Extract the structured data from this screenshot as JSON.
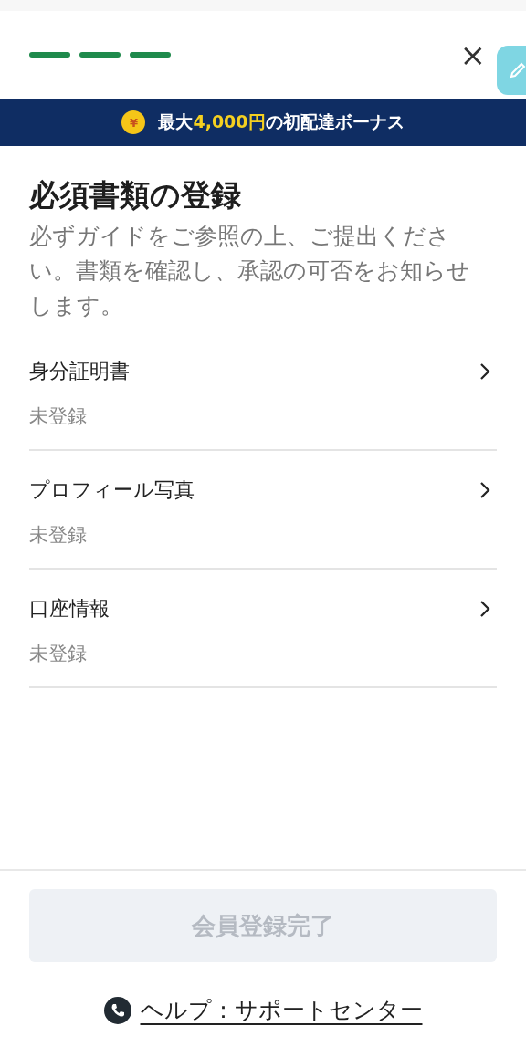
{
  "progress": {
    "steps": [
      {
        "done": true
      },
      {
        "done": true
      },
      {
        "done": true
      }
    ]
  },
  "close": {
    "label": "×"
  },
  "banner": {
    "coin": "¥",
    "prefix": "最大",
    "highlight": "4,000円",
    "suffix": "の初配達ボーナス"
  },
  "title": "必須書類の登録",
  "description": "必ずガイドをご参照の上、ご提出ください。書類を確認し、承認の可否をお知らせします。",
  "documents": [
    {
      "name": "身分証明書",
      "status": "未登録"
    },
    {
      "name": "プロフィール写真",
      "status": "未登録"
    },
    {
      "name": "口座情報",
      "status": "未登録"
    }
  ],
  "submit": {
    "label": "会員登録完了",
    "disabled": true
  },
  "help": {
    "label": "ヘルプ：サポートセンター"
  }
}
